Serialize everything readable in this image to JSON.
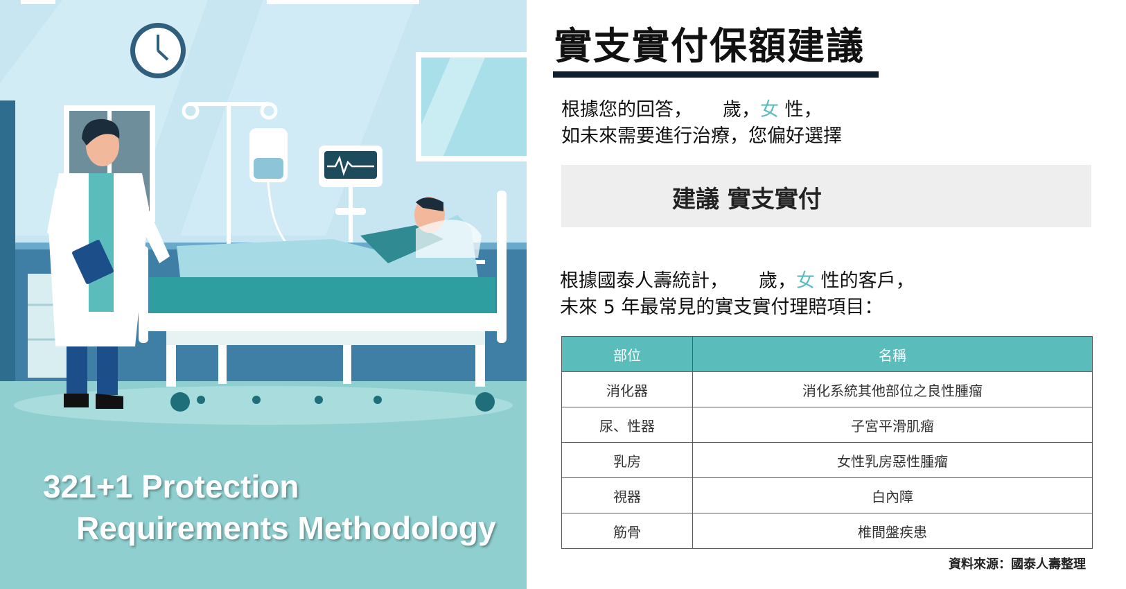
{
  "illustration": {
    "banner_line1": "321+1 Protection",
    "banner_line2": "Requirements Methodology"
  },
  "title": "實支實付保額建議",
  "intro": {
    "prefix": "根據您的回答，",
    "age_unit": "歲，",
    "gender": "女",
    "gender_suffix": "性，",
    "line2": "如未來需要進行治療，您偏好選擇"
  },
  "recommendation": "建議 實支實付",
  "stats": {
    "prefix": "根據國泰人壽統計，",
    "age_unit": "歲，",
    "gender": "女",
    "gender_suffix": "性的客戶，",
    "line2": "未來 5 年最常見的實支實付理賠項目："
  },
  "table": {
    "headers": [
      "部位",
      "名稱"
    ],
    "rows": [
      [
        "消化器",
        "消化系統其他部位之良性腫瘤"
      ],
      [
        "尿、性器",
        "子宮平滑肌瘤"
      ],
      [
        "乳房",
        "女性乳房惡性腫瘤"
      ],
      [
        "視器",
        "白內障"
      ],
      [
        "筋骨",
        "椎間盤疾患"
      ]
    ]
  },
  "source": "資料來源：國泰人壽整理",
  "colors": {
    "accent": "#5bbcbc",
    "title_bar": "#0f1f2b",
    "box_bg": "#eeeeee"
  }
}
